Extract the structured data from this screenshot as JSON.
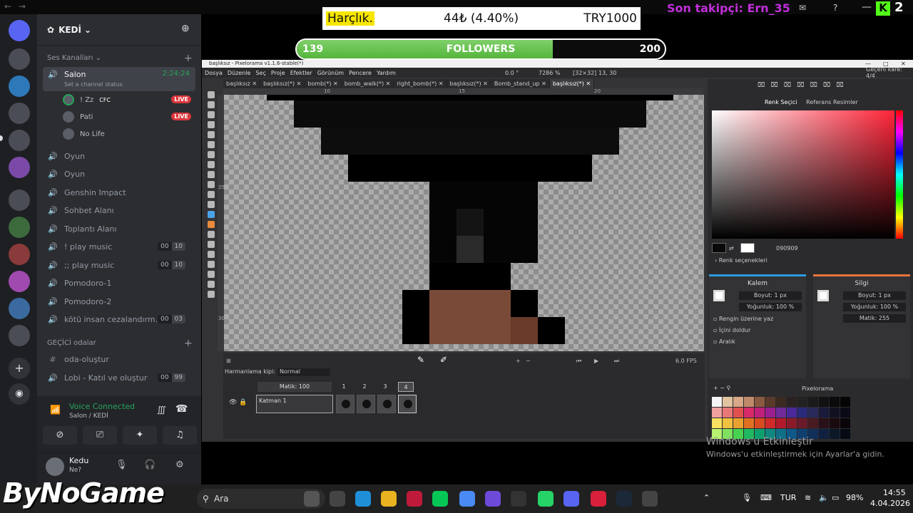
{
  "overlays": {
    "money_label": "Harçlık.",
    "money_amount": "44₺ (4.40%)",
    "money_goal": "TRY1000",
    "followers_current": "139",
    "followers_label": "FOLLOWERS",
    "followers_goal": "200",
    "followers_progress": 0.695,
    "last_follower": "Son takipçi: Ern_35",
    "corner_count": "2",
    "watermark_brand": "ByNoGame"
  },
  "discord": {
    "server_name": "KEDİ",
    "voice_category": "Ses Kanalları",
    "active_channel": "Salon",
    "active_channel_timer": "2:24:24",
    "channel_topic": "Set a channel status",
    "voice_users": [
      {
        "name": "! Zz",
        "tag": "CFC",
        "live": true
      },
      {
        "name": "Pati",
        "live": true
      },
      {
        "name": "No Life",
        "live": false
      }
    ],
    "live_label": "LIVE",
    "channels": [
      {
        "name": "Oyun",
        "type": "voice"
      },
      {
        "name": "Oyun",
        "type": "voice"
      },
      {
        "name": "Genshin Impact",
        "type": "voice"
      },
      {
        "name": "Sohbet Alanı",
        "type": "voice"
      },
      {
        "name": "Toplantı Alanı",
        "type": "voice"
      },
      {
        "name": "! play music",
        "type": "voice",
        "count": "00",
        "limit": "10"
      },
      {
        "name": ";; play music",
        "type": "voice",
        "count": "00",
        "limit": "10"
      },
      {
        "name": "Pomodoro-1",
        "type": "voice"
      },
      {
        "name": "Pomodoro-2",
        "type": "voice"
      },
      {
        "name": "kötü insan cezalandırm...",
        "type": "voice",
        "count": "00",
        "limit": "03"
      }
    ],
    "temp_category": "GEÇİCİ odalar",
    "temp_channels": [
      {
        "name": "oda-oluştur",
        "type": "text"
      },
      {
        "name": "Lobi - Katıl ve oluştur",
        "type": "voice",
        "count": "00",
        "limit": "99"
      }
    ],
    "voice_status": "Voice Connected",
    "voice_location": "Salon / KEDİ",
    "user_name": "Kedu",
    "user_status": "Ne?"
  },
  "pixelorama": {
    "window_title": "başlıksız - Pixelorama v1.1.6-stable(*)",
    "menus": [
      "Dosya",
      "Düzenle",
      "Seç",
      "Proje",
      "Efektler",
      "Görünüm",
      "Pencere",
      "Yardım"
    ],
    "rotation": "0.0 °",
    "zoom": "7286 %",
    "canvas_size": "[32×32]",
    "cursor_pos": "13, 30",
    "current_frame": "Geçerli kare: 4/4",
    "tabs": [
      "başlıksız",
      "başlıksız(*)",
      "bomb(*)",
      "bomb_walk(*)",
      "right_bomb(*)",
      "başlıksız(*)",
      "Bomb_stand_up",
      "başlıksız(*)"
    ],
    "ruler_top": [
      "10",
      "15",
      "20"
    ],
    "ruler_left": [
      "25",
      "30"
    ],
    "blend_label": "Harmanlama kipi:",
    "blend_value": "Normal",
    "opacity_label": "Matik: 100",
    "frame_numbers": [
      "1",
      "2",
      "3",
      "4"
    ],
    "layer_name": "Katman 1",
    "fps": "6.0 FPS",
    "right_tabs": [
      "Renk Seçici",
      "Referans Resimler"
    ],
    "hex_value": "090909",
    "color_options": "Renk seçenekleri",
    "left_tool": "Kalem",
    "right_tool": "Silgi",
    "size_label": "Boyut: 1 px",
    "density_label": "Yoğunluk: 100 %",
    "alpha_label": "Matik: 255",
    "options": [
      "Rengin üzerine yaz",
      "İçini doldur",
      "Aralık"
    ],
    "palette_name": "Pixelorama",
    "colors": {
      "primary": "#090909",
      "secondary": "#ffffff",
      "left_accent": "#2b9ae0",
      "right_accent": "#e8743a"
    }
  },
  "windows": {
    "watermark_title": "Windows'u Etkinleştir",
    "watermark_text": "Windows'u etkinleştirmek için Ayarlar'a gidin.",
    "search": "Ara",
    "lang": "TUR",
    "battery": "98%",
    "time": "14:55",
    "date": "4.04.2026"
  }
}
